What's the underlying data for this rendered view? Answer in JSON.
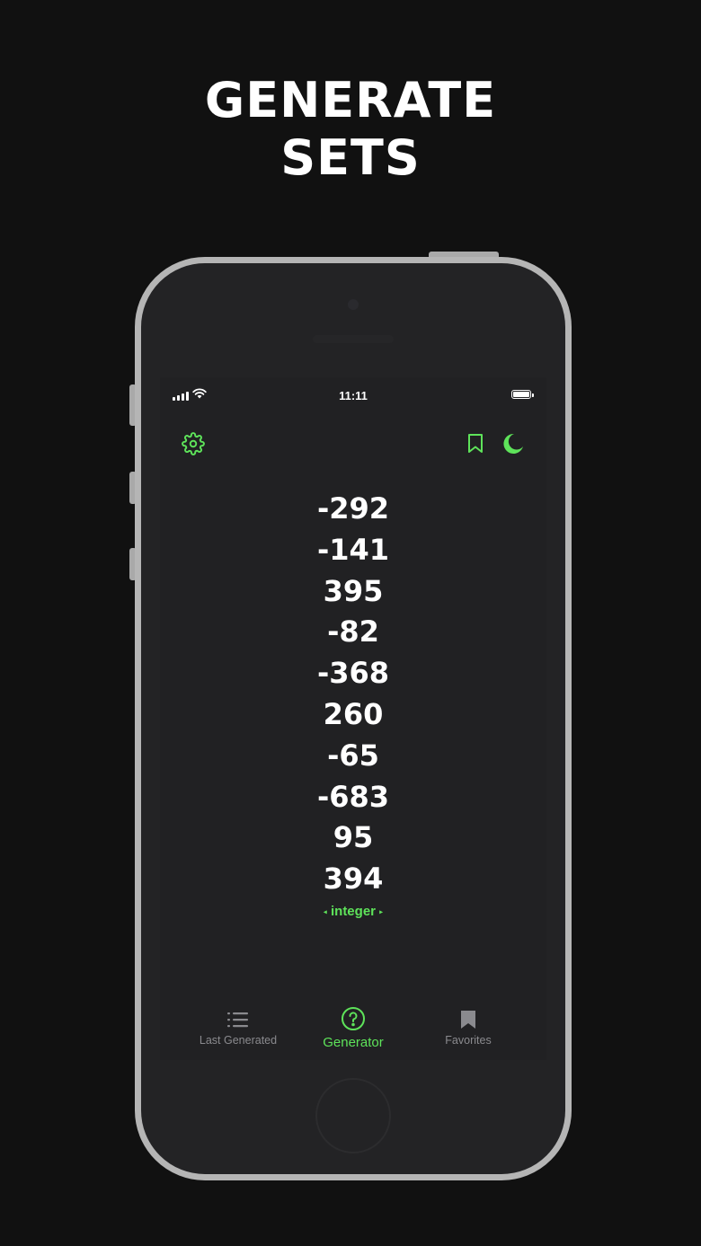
{
  "headline": {
    "line1": "GENERATE",
    "line2": "SETS"
  },
  "status_bar": {
    "time": "11:11"
  },
  "colors": {
    "accent": "#5ee35a",
    "background": "#111111",
    "screen": "#212123",
    "frame": "#b5b5b5",
    "inactive": "#8a8a8e"
  },
  "toolbar": {
    "settings_icon": "gear-icon",
    "favorite_icon": "bookmark-icon",
    "theme_icon": "moon-icon"
  },
  "numbers": [
    "-292",
    "-141",
    "395",
    "-82",
    "-368",
    "260",
    "-65",
    "-683",
    "95",
    "394"
  ],
  "type_selector": {
    "left_arrow": "◂",
    "label": "integer",
    "right_arrow": "▸"
  },
  "tabs": [
    {
      "label": "Last Generated",
      "icon": "list-icon",
      "active": false
    },
    {
      "label": "Generator",
      "icon": "question-circle-icon",
      "active": true
    },
    {
      "label": "Favorites",
      "icon": "bookmark-filled-icon",
      "active": false
    }
  ]
}
